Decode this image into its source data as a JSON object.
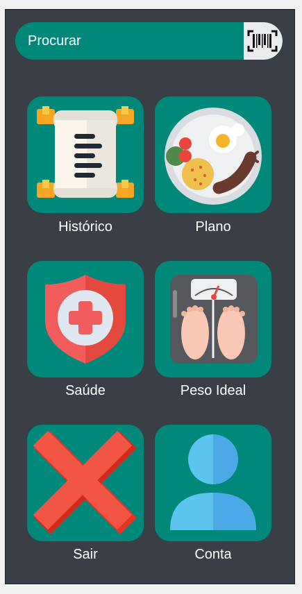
{
  "search": {
    "placeholder": "Procurar",
    "scan_icon": "barcode-icon"
  },
  "menu": [
    {
      "label": "Histórico",
      "icon": "scroll-icon"
    },
    {
      "label": "Plano",
      "icon": "food-plate-icon"
    },
    {
      "label": "Saúde",
      "icon": "health-shield-icon"
    },
    {
      "label": "Peso Ideal",
      "icon": "weight-scale-icon"
    },
    {
      "label": "Sair",
      "icon": "exit-x-icon"
    },
    {
      "label": "Conta",
      "icon": "user-account-icon"
    }
  ],
  "colors": {
    "background": "#3a3e47",
    "accent": "#00897b",
    "text": "#ffffff"
  }
}
